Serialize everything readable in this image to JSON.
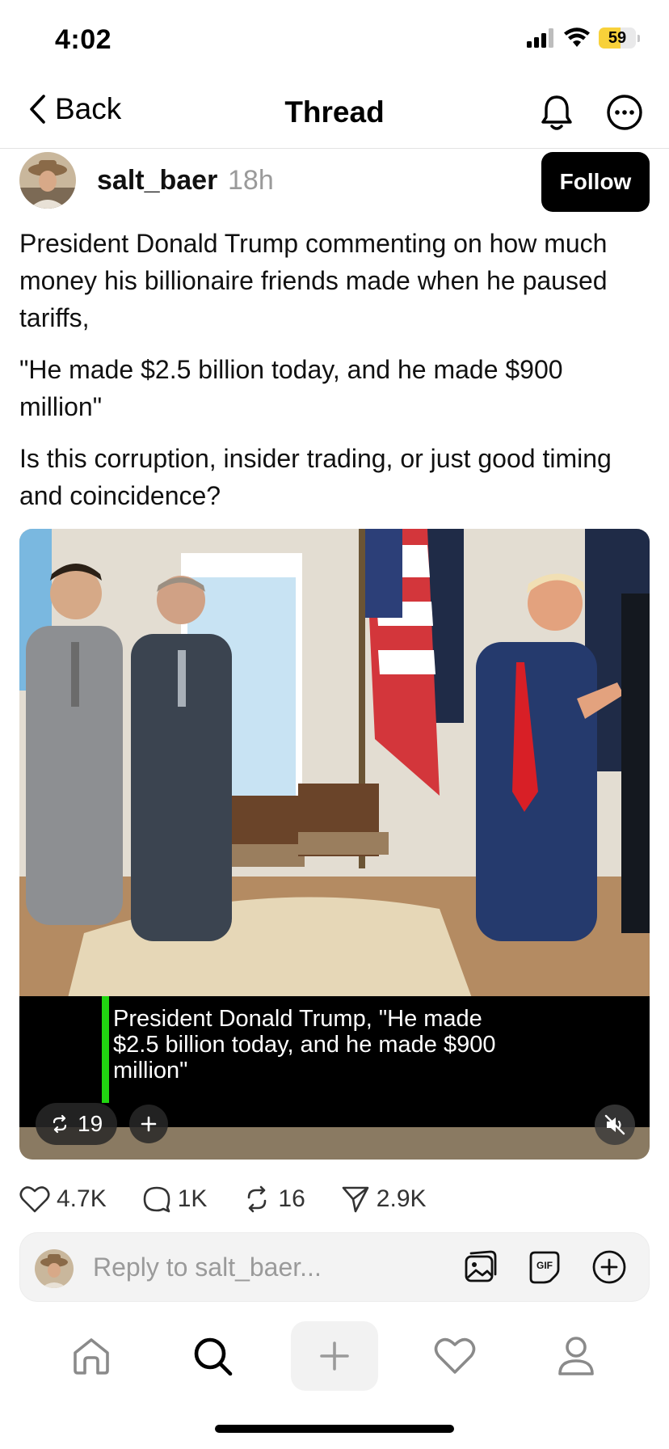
{
  "status_bar": {
    "time": "4:02",
    "battery_percent": "59",
    "battery_level": 0.59
  },
  "nav": {
    "back_label": "Back",
    "title": "Thread"
  },
  "post": {
    "username": "salt_baer",
    "time": "18h",
    "follow_label": "Follow",
    "paragraphs": [
      "President Donald Trump commenting on how much money his billionaire friends made when he paused tariffs,",
      "\"He made $2.5 billion today, and he made $900 million\"",
      "Is this corruption, insider trading, or just good timing and coincidence?"
    ],
    "media": {
      "caption": "President Donald Trump, \"He made $2.5 billion today, and he made $900 million\"",
      "repost_count": "19"
    },
    "actions": {
      "likes": "4.7K",
      "replies": "1K",
      "reposts": "16",
      "shares": "2.9K"
    }
  },
  "reply": {
    "placeholder": "Reply to salt_baer..."
  },
  "tab_bar": {
    "items": [
      "home",
      "search",
      "compose",
      "activity",
      "profile"
    ]
  },
  "colors": {
    "follow_bg": "#000000",
    "caption_accent": "#21d611",
    "battery": "#f8d13a"
  }
}
